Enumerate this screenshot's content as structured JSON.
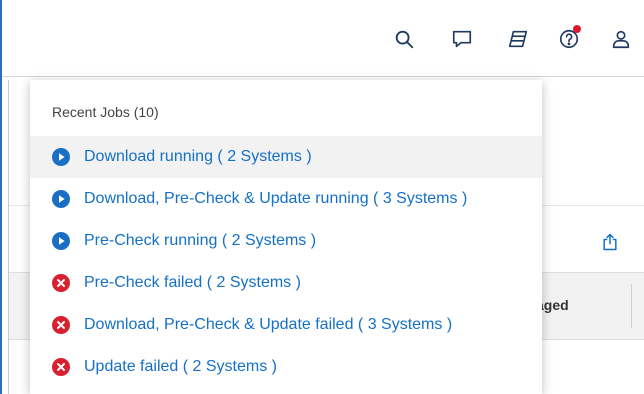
{
  "header": {
    "icons": [
      "search-icon",
      "chat-icon",
      "layers-icon",
      "help-icon",
      "user-icon"
    ],
    "accent_color": "#1470c8",
    "badge_color": "#e0182d"
  },
  "background": {
    "table": {
      "visible_column": "Staged"
    }
  },
  "recent_jobs": {
    "title": "Recent Jobs (10)",
    "items": [
      {
        "status": "running",
        "icon": "play-circle-icon",
        "label": "Download running ( 2 Systems )"
      },
      {
        "status": "running",
        "icon": "play-circle-icon",
        "label": "Download, Pre-Check & Update running ( 3 Systems )"
      },
      {
        "status": "running",
        "icon": "play-circle-icon",
        "label": "Pre-Check running ( 2 Systems )"
      },
      {
        "status": "failed",
        "icon": "error-circle-icon",
        "label": "Pre-Check failed ( 2 Systems )"
      },
      {
        "status": "failed",
        "icon": "error-circle-icon",
        "label": "Download, Pre-Check & Update failed ( 3 Systems )"
      },
      {
        "status": "failed",
        "icon": "error-circle-icon",
        "label": "Update failed ( 2 Systems )"
      }
    ],
    "status_colors": {
      "running": "#1a6fc4",
      "failed": "#d8202f"
    }
  }
}
